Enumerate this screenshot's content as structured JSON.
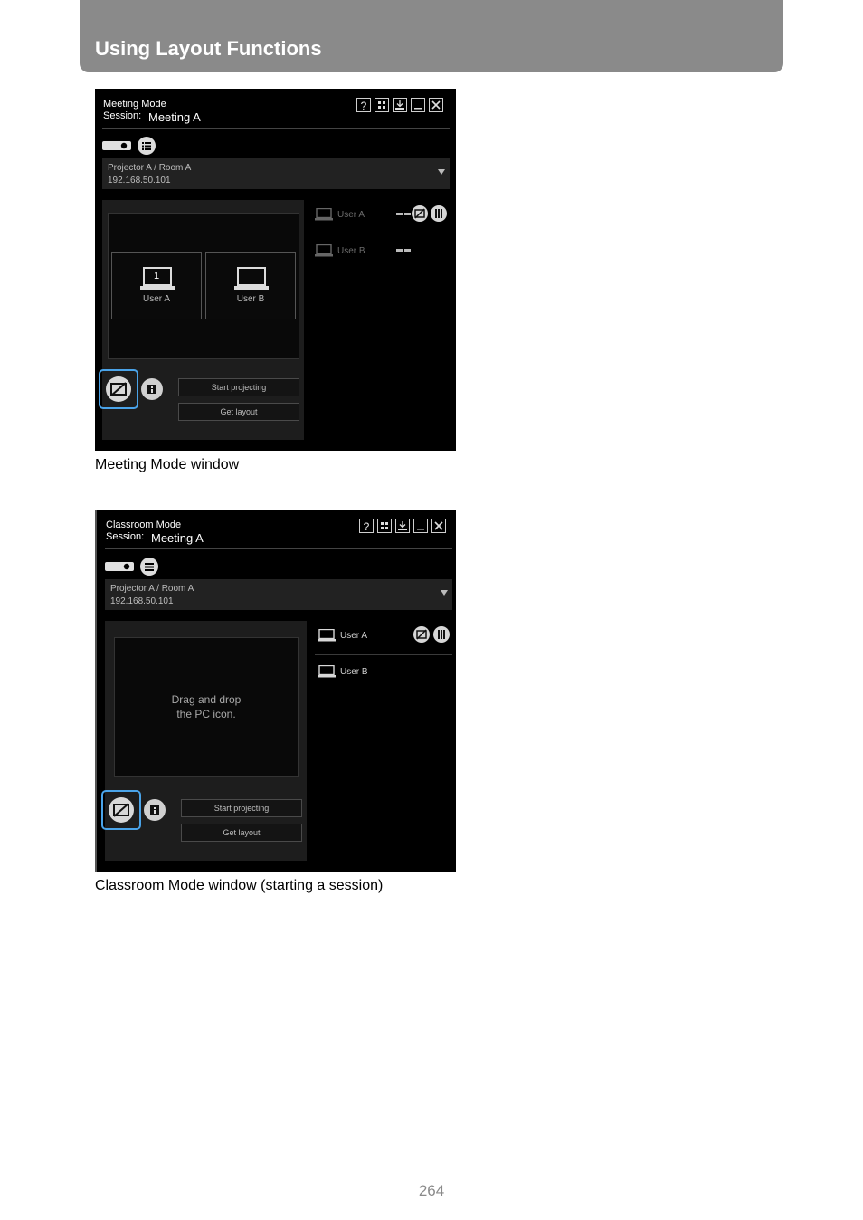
{
  "header": {
    "title": "Using Layout Functions"
  },
  "meeting": {
    "mode_title": "Meeting Mode",
    "session_label": "Session:",
    "session_name": "Meeting A",
    "help_label": "?",
    "projector_line1": "Projector A / Room A",
    "projector_line2": "192.168.50.101",
    "slots": [
      {
        "number": "1",
        "label": "User A"
      },
      {
        "number": "",
        "label": "User B"
      }
    ],
    "users": [
      {
        "name": "User A"
      },
      {
        "name": "User B"
      }
    ],
    "start_label": "Start projecting",
    "get_layout_label": "Get layout",
    "caption": "Meeting Mode window"
  },
  "classroom": {
    "mode_title": "Classroom Mode",
    "session_label": "Session:",
    "session_name": "Meeting A",
    "help_label": "?",
    "projector_line1": "Projector A / Room A",
    "projector_line2": "192.168.50.101",
    "drag_line1": "Drag and drop",
    "drag_line2": "the PC icon.",
    "users": [
      {
        "name": "User A"
      },
      {
        "name": "User B"
      }
    ],
    "start_label": "Start projecting",
    "get_layout_label": "Get layout",
    "caption": "Classroom Mode window (starting a session)"
  },
  "footer": {
    "page_number": "264"
  },
  "colors": {
    "header_bg": "#8a8a8a",
    "highlight_blue": "#4aa3e8",
    "window_bg": "#000000"
  }
}
